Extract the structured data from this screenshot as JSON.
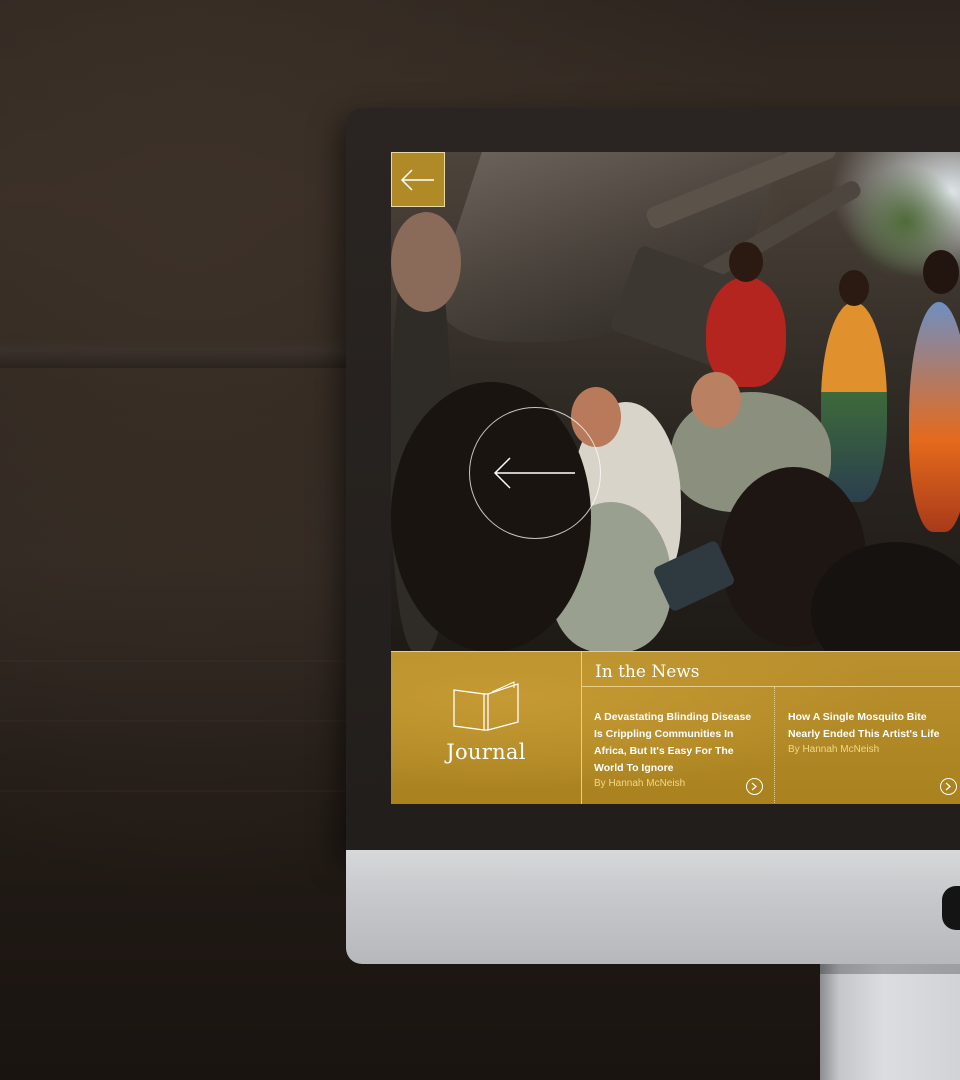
{
  "hero": {
    "back_icon": "arrow-left-icon",
    "prev_icon": "arrow-left-circle-icon"
  },
  "journal": {
    "icon": "open-book-icon",
    "title": "Journal"
  },
  "news": {
    "heading": "In the News",
    "articles": [
      {
        "title": "A Devastating Blinding Disease Is Crippling Communities In Africa, But It's Easy For The World To Ignore",
        "byline": "By Hannah McNeish"
      },
      {
        "title": "How A Single Mosquito Bite Nearly Ended This Artist's Life",
        "byline": "By Hannah McNeish"
      }
    ],
    "more_icon": "chevron-right-circle-icon"
  },
  "colors": {
    "gold": "#b08a26",
    "gold_line": "#e6cf8c",
    "byline": "#f0d98a"
  }
}
